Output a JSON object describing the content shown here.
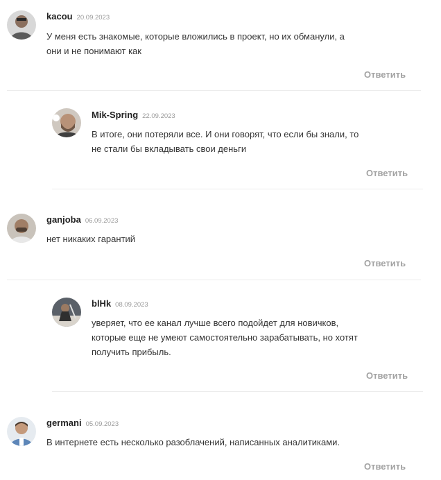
{
  "comments": [
    {
      "author": "kacou",
      "date": "20.09.2023",
      "text": "У меня есть знакомые, которые вложились в проект, но их обманули, а они и не понимают как",
      "reply": "Ответить",
      "avatar_color": "#6b6b6b"
    },
    {
      "author": "Mik-Spring",
      "date": "22.09.2023",
      "text": "В итоге, они потеряли все. И они говорят, что если бы знали, то не стали бы вкладывать свои деньги",
      "reply": "Ответить",
      "avatar_color": "#8a7a6e"
    },
    {
      "author": "ganjoba",
      "date": "06.09.2023",
      "text": "нет никаких гарантий",
      "reply": "Ответить",
      "avatar_color": "#7d6b5c"
    },
    {
      "author": "blHk",
      "date": "08.09.2023",
      "text": "уверяет, что ее канал лучше всего подойдет для новичков, которые еще не умеют самостоятельно зарабатывать, но хотят получить прибыль.",
      "reply": "Ответить",
      "avatar_color": "#4a4f5a"
    },
    {
      "author": "germani",
      "date": "05.09.2023",
      "text": "В интернете есть несколько разоблачений, написанных аналитиками.",
      "reply": "Ответить",
      "avatar_color": "#5d86b8"
    }
  ]
}
